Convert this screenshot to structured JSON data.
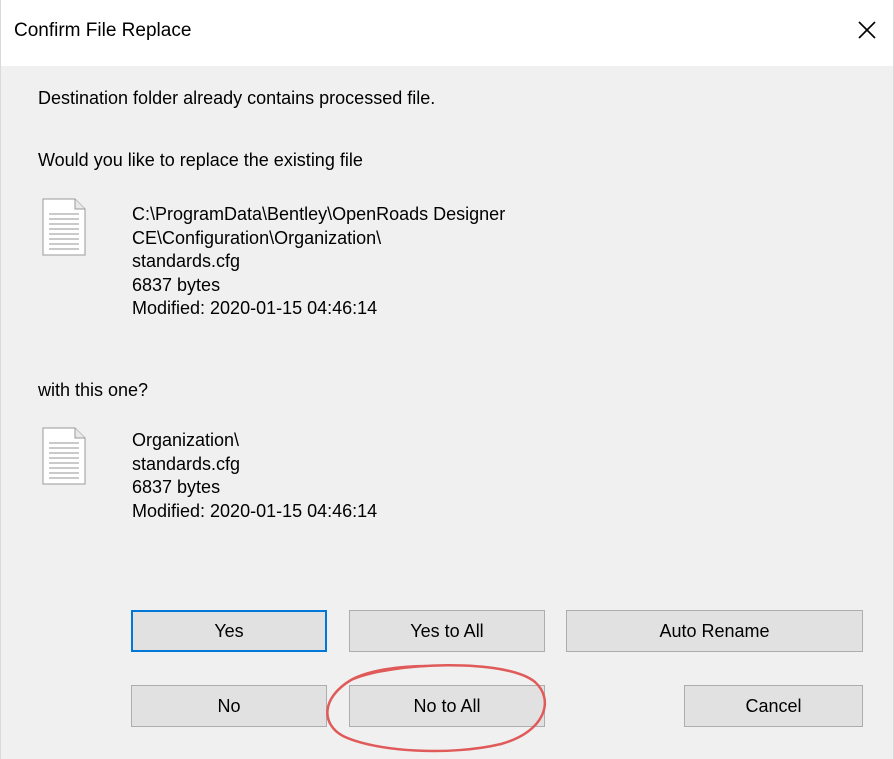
{
  "window": {
    "title": "Confirm File Replace",
    "close_icon": "close-icon"
  },
  "messages": {
    "destination_notice": "Destination folder already contains processed file.",
    "replace_question": "Would you like to replace the existing file",
    "with_question": "with this one?"
  },
  "existing_file": {
    "icon": "document-icon",
    "lines": [
      "C:\\ProgramData\\Bentley\\OpenRoads Designer",
      "CE\\Configuration\\Organization\\",
      "standards.cfg",
      "6837 bytes",
      "Modified: 2020-01-15 04:46:14"
    ]
  },
  "new_file": {
    "icon": "document-icon",
    "lines": [
      "Organization\\",
      "standards.cfg",
      "6837 bytes",
      "Modified: 2020-01-15 04:46:14"
    ]
  },
  "buttons": {
    "yes": "Yes",
    "yes_to_all": "Yes to All",
    "auto_rename": "Auto Rename",
    "no": "No",
    "no_to_all": "No to All",
    "cancel": "Cancel"
  },
  "colors": {
    "dialog_bg": "#f0f0f0",
    "button_bg": "#e1e1e1",
    "default_button_border": "#0078d7",
    "annotation_circle": "#e05a5a"
  }
}
